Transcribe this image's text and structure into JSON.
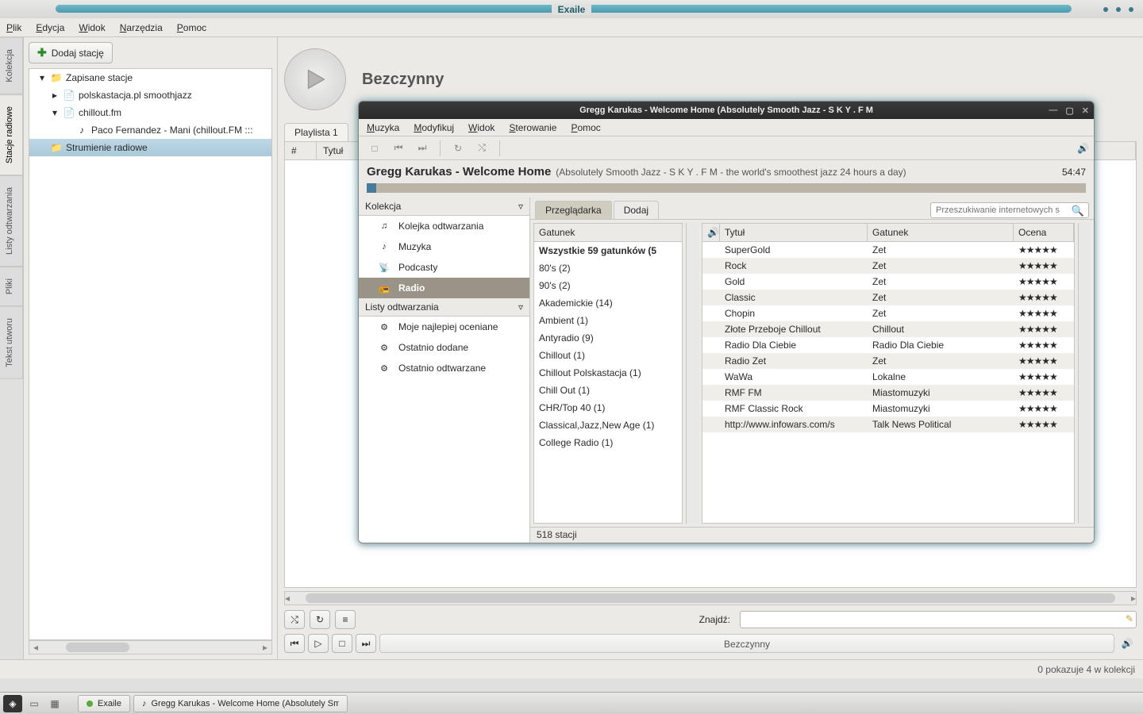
{
  "window": {
    "title": "Exaile"
  },
  "main_menu": [
    "Plik",
    "Edycja",
    "Widok",
    "Narzędzia",
    "Pomoc"
  ],
  "side_tabs": [
    "Kolekcja",
    "Stacje radiowe",
    "Listy odtwarzania",
    "Pliki",
    "Tekst utworu"
  ],
  "active_side_tab": 1,
  "left_panel": {
    "add_button": "Dodaj stację",
    "tree": [
      {
        "level": 0,
        "exp": "▾",
        "icon": "folder",
        "label": "Zapisane stacje"
      },
      {
        "level": 1,
        "exp": "▸",
        "icon": "file",
        "label": "polskastacja.pl smoothjazz"
      },
      {
        "level": 1,
        "exp": "▾",
        "icon": "file",
        "label": "chillout.fm"
      },
      {
        "level": 2,
        "exp": "",
        "icon": "music",
        "label": "Paco Fernandez - Mani (chillout.FM :::"
      },
      {
        "level": 0,
        "exp": "",
        "icon": "folder",
        "label": "Strumienie radiowe",
        "sel": true
      }
    ]
  },
  "main": {
    "idle": "Bezczynny",
    "playlist_tab": "Playlista 1",
    "columns": {
      "num": "#",
      "title": "Tytuł"
    },
    "find_label": "Znajdź:",
    "control_idle": "Bezczynny",
    "status": "0 pokazuje 4 w kolekcji"
  },
  "win2": {
    "title": "Gregg Karukas - Welcome Home (Absolutely Smooth Jazz - S K Y . F M",
    "menu": [
      "Muzyka",
      "Modyfikuj",
      "Widok",
      "Sterowanie",
      "Pomoc"
    ],
    "track_title": "Gregg Karukas - Welcome Home",
    "track_sub": "(Absolutely Smooth Jazz - S K Y . F M - the world's smoothest jazz 24 hours a day)",
    "track_time": "54:47",
    "left_sections": {
      "kolekcja": {
        "label": "Kolekcja",
        "items": [
          {
            "icon": "queue",
            "label": "Kolejka odtwarzania"
          },
          {
            "icon": "music",
            "label": "Muzyka"
          },
          {
            "icon": "podcast",
            "label": "Podcasty"
          },
          {
            "icon": "radio",
            "label": "Radio",
            "sel": true
          }
        ]
      },
      "listy": {
        "label": "Listy odtwarzania",
        "items": [
          {
            "icon": "gear",
            "label": "Moje najlepiej oceniane"
          },
          {
            "icon": "gear",
            "label": "Ostatnio dodane"
          },
          {
            "icon": "gear",
            "label": "Ostatnio odtwarzane"
          }
        ]
      }
    },
    "tabs": {
      "browse": "Przeglądarka",
      "add": "Dodaj"
    },
    "search_placeholder": "Przeszukiwanie internetowych s",
    "genre_header": "Gatunek",
    "genres": [
      "Wszystkie 59 gatunków (5",
      "80's (2)",
      "90's (2)",
      "Akademickie (14)",
      "Ambient (1)",
      "Antyradio (9)",
      "Chillout (1)",
      "Chillout Polskastacja (1)",
      "Chill Out (1)",
      "CHR/Top 40 (1)",
      "Classical,Jazz,New Age (1)",
      "College Radio (1)"
    ],
    "station_header": {
      "play": "🔊",
      "title": "Tytuł",
      "genre": "Gatunek",
      "rating": "Ocena"
    },
    "stations": [
      {
        "title": "SuperGold",
        "genre": "Zet",
        "rating": "★★★★★"
      },
      {
        "title": "Rock",
        "genre": "Zet",
        "rating": "★★★★★"
      },
      {
        "title": "Gold",
        "genre": "Zet",
        "rating": "★★★★★"
      },
      {
        "title": "Classic",
        "genre": "Zet",
        "rating": "★★★★★"
      },
      {
        "title": "Chopin",
        "genre": "Zet",
        "rating": "★★★★★"
      },
      {
        "title": "Złote Przeboje Chillout",
        "genre": "Chillout",
        "rating": "★★★★★"
      },
      {
        "title": "Radio Dla Ciebie",
        "genre": "Radio Dla Ciebie",
        "rating": "★★★★★"
      },
      {
        "title": "Radio Zet",
        "genre": "Zet",
        "rating": "★★★★★"
      },
      {
        "title": "WaWa",
        "genre": "Lokalne",
        "rating": "★★★★★"
      },
      {
        "title": "RMF FM",
        "genre": "Miastomuzyki",
        "rating": "★★★★★"
      },
      {
        "title": "RMF Classic Rock",
        "genre": "Miastomuzyki",
        "rating": "★★★★★"
      },
      {
        "title": "http://www.infowars.com/s",
        "genre": "Talk News Political",
        "rating": "★★★★★"
      }
    ],
    "status": "518 stacji"
  },
  "taskbar": {
    "items": [
      {
        "label": "Exaile"
      },
      {
        "label": "Gregg Karukas - Welcome Home (Absolutely Sm"
      }
    ]
  }
}
